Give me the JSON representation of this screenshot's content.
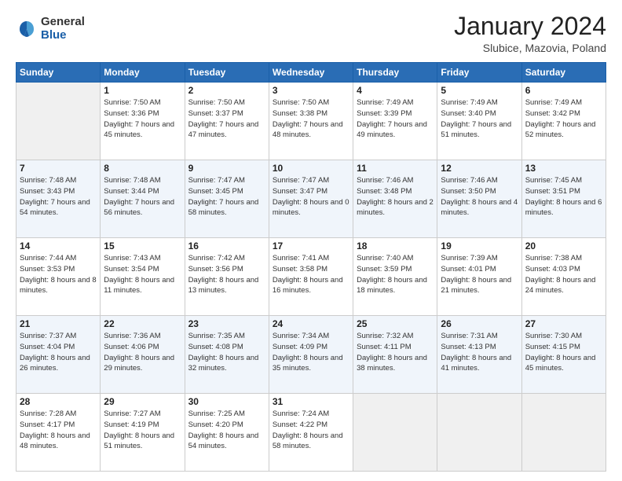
{
  "logo": {
    "general": "General",
    "blue": "Blue"
  },
  "title": "January 2024",
  "location": "Slubice, Mazovia, Poland",
  "days_of_week": [
    "Sunday",
    "Monday",
    "Tuesday",
    "Wednesday",
    "Thursday",
    "Friday",
    "Saturday"
  ],
  "weeks": [
    [
      {
        "day": "",
        "sunrise": "",
        "sunset": "",
        "daylight": ""
      },
      {
        "day": "1",
        "sunrise": "Sunrise: 7:50 AM",
        "sunset": "Sunset: 3:36 PM",
        "daylight": "Daylight: 7 hours and 45 minutes."
      },
      {
        "day": "2",
        "sunrise": "Sunrise: 7:50 AM",
        "sunset": "Sunset: 3:37 PM",
        "daylight": "Daylight: 7 hours and 47 minutes."
      },
      {
        "day": "3",
        "sunrise": "Sunrise: 7:50 AM",
        "sunset": "Sunset: 3:38 PM",
        "daylight": "Daylight: 7 hours and 48 minutes."
      },
      {
        "day": "4",
        "sunrise": "Sunrise: 7:49 AM",
        "sunset": "Sunset: 3:39 PM",
        "daylight": "Daylight: 7 hours and 49 minutes."
      },
      {
        "day": "5",
        "sunrise": "Sunrise: 7:49 AM",
        "sunset": "Sunset: 3:40 PM",
        "daylight": "Daylight: 7 hours and 51 minutes."
      },
      {
        "day": "6",
        "sunrise": "Sunrise: 7:49 AM",
        "sunset": "Sunset: 3:42 PM",
        "daylight": "Daylight: 7 hours and 52 minutes."
      }
    ],
    [
      {
        "day": "7",
        "sunrise": "Sunrise: 7:48 AM",
        "sunset": "Sunset: 3:43 PM",
        "daylight": "Daylight: 7 hours and 54 minutes."
      },
      {
        "day": "8",
        "sunrise": "Sunrise: 7:48 AM",
        "sunset": "Sunset: 3:44 PM",
        "daylight": "Daylight: 7 hours and 56 minutes."
      },
      {
        "day": "9",
        "sunrise": "Sunrise: 7:47 AM",
        "sunset": "Sunset: 3:45 PM",
        "daylight": "Daylight: 7 hours and 58 minutes."
      },
      {
        "day": "10",
        "sunrise": "Sunrise: 7:47 AM",
        "sunset": "Sunset: 3:47 PM",
        "daylight": "Daylight: 8 hours and 0 minutes."
      },
      {
        "day": "11",
        "sunrise": "Sunrise: 7:46 AM",
        "sunset": "Sunset: 3:48 PM",
        "daylight": "Daylight: 8 hours and 2 minutes."
      },
      {
        "day": "12",
        "sunrise": "Sunrise: 7:46 AM",
        "sunset": "Sunset: 3:50 PM",
        "daylight": "Daylight: 8 hours and 4 minutes."
      },
      {
        "day": "13",
        "sunrise": "Sunrise: 7:45 AM",
        "sunset": "Sunset: 3:51 PM",
        "daylight": "Daylight: 8 hours and 6 minutes."
      }
    ],
    [
      {
        "day": "14",
        "sunrise": "Sunrise: 7:44 AM",
        "sunset": "Sunset: 3:53 PM",
        "daylight": "Daylight: 8 hours and 8 minutes."
      },
      {
        "day": "15",
        "sunrise": "Sunrise: 7:43 AM",
        "sunset": "Sunset: 3:54 PM",
        "daylight": "Daylight: 8 hours and 11 minutes."
      },
      {
        "day": "16",
        "sunrise": "Sunrise: 7:42 AM",
        "sunset": "Sunset: 3:56 PM",
        "daylight": "Daylight: 8 hours and 13 minutes."
      },
      {
        "day": "17",
        "sunrise": "Sunrise: 7:41 AM",
        "sunset": "Sunset: 3:58 PM",
        "daylight": "Daylight: 8 hours and 16 minutes."
      },
      {
        "day": "18",
        "sunrise": "Sunrise: 7:40 AM",
        "sunset": "Sunset: 3:59 PM",
        "daylight": "Daylight: 8 hours and 18 minutes."
      },
      {
        "day": "19",
        "sunrise": "Sunrise: 7:39 AM",
        "sunset": "Sunset: 4:01 PM",
        "daylight": "Daylight: 8 hours and 21 minutes."
      },
      {
        "day": "20",
        "sunrise": "Sunrise: 7:38 AM",
        "sunset": "Sunset: 4:03 PM",
        "daylight": "Daylight: 8 hours and 24 minutes."
      }
    ],
    [
      {
        "day": "21",
        "sunrise": "Sunrise: 7:37 AM",
        "sunset": "Sunset: 4:04 PM",
        "daylight": "Daylight: 8 hours and 26 minutes."
      },
      {
        "day": "22",
        "sunrise": "Sunrise: 7:36 AM",
        "sunset": "Sunset: 4:06 PM",
        "daylight": "Daylight: 8 hours and 29 minutes."
      },
      {
        "day": "23",
        "sunrise": "Sunrise: 7:35 AM",
        "sunset": "Sunset: 4:08 PM",
        "daylight": "Daylight: 8 hours and 32 minutes."
      },
      {
        "day": "24",
        "sunrise": "Sunrise: 7:34 AM",
        "sunset": "Sunset: 4:09 PM",
        "daylight": "Daylight: 8 hours and 35 minutes."
      },
      {
        "day": "25",
        "sunrise": "Sunrise: 7:32 AM",
        "sunset": "Sunset: 4:11 PM",
        "daylight": "Daylight: 8 hours and 38 minutes."
      },
      {
        "day": "26",
        "sunrise": "Sunrise: 7:31 AM",
        "sunset": "Sunset: 4:13 PM",
        "daylight": "Daylight: 8 hours and 41 minutes."
      },
      {
        "day": "27",
        "sunrise": "Sunrise: 7:30 AM",
        "sunset": "Sunset: 4:15 PM",
        "daylight": "Daylight: 8 hours and 45 minutes."
      }
    ],
    [
      {
        "day": "28",
        "sunrise": "Sunrise: 7:28 AM",
        "sunset": "Sunset: 4:17 PM",
        "daylight": "Daylight: 8 hours and 48 minutes."
      },
      {
        "day": "29",
        "sunrise": "Sunrise: 7:27 AM",
        "sunset": "Sunset: 4:19 PM",
        "daylight": "Daylight: 8 hours and 51 minutes."
      },
      {
        "day": "30",
        "sunrise": "Sunrise: 7:25 AM",
        "sunset": "Sunset: 4:20 PM",
        "daylight": "Daylight: 8 hours and 54 minutes."
      },
      {
        "day": "31",
        "sunrise": "Sunrise: 7:24 AM",
        "sunset": "Sunset: 4:22 PM",
        "daylight": "Daylight: 8 hours and 58 minutes."
      },
      {
        "day": "",
        "sunrise": "",
        "sunset": "",
        "daylight": ""
      },
      {
        "day": "",
        "sunrise": "",
        "sunset": "",
        "daylight": ""
      },
      {
        "day": "",
        "sunrise": "",
        "sunset": "",
        "daylight": ""
      }
    ]
  ]
}
